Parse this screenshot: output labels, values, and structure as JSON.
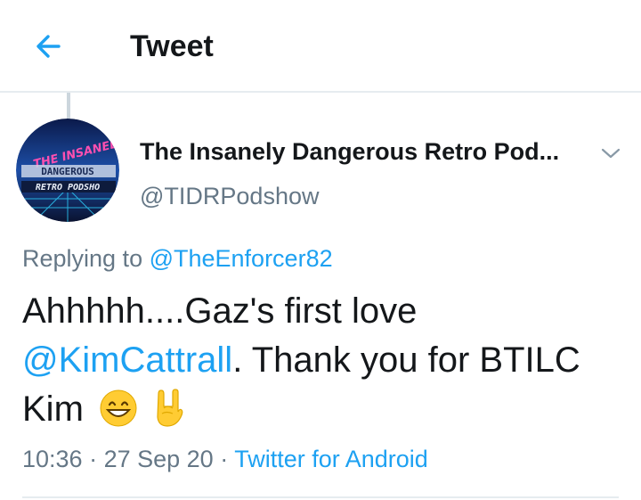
{
  "header": {
    "title": "Tweet",
    "back_icon": "arrow-left-icon",
    "accent_color": "#1da1f2"
  },
  "tweet": {
    "avatar_icon": "podcast-logo-avatar",
    "display_name": "The Insanely Dangerous Retro Pod...",
    "handle": "@TIDRPodshow",
    "menu_icon": "chevron-down-icon",
    "replying_prefix": "Replying to ",
    "replying_to": "@TheEnforcer82",
    "text_part1": "Ahhhhh....Gaz's first love ",
    "mention": "@KimCattrall",
    "text_part2": ". Thank you for BTILC Kim",
    "emojis": [
      "grinning-face-emoji",
      "sign-of-horns-emoji"
    ],
    "time": "10:36",
    "separator": " · ",
    "date": "27 Sep 20",
    "source": "Twitter for Android"
  },
  "colors": {
    "text_primary": "#14171a",
    "text_secondary": "#657786",
    "link": "#1da1f2",
    "divider": "#e6ecf0"
  }
}
